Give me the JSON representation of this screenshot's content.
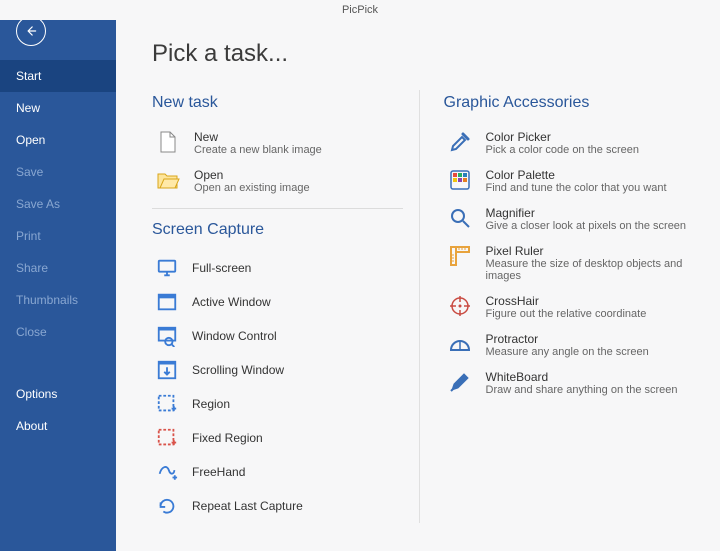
{
  "titlebar": {
    "title": "PicPick"
  },
  "sidebar": {
    "items": [
      {
        "label": "Start",
        "cls": "bright active"
      },
      {
        "label": "New",
        "cls": "bright"
      },
      {
        "label": "Open",
        "cls": "bright"
      },
      {
        "label": "Save",
        "cls": "dim"
      },
      {
        "label": "Save As",
        "cls": "dim"
      },
      {
        "label": "Print",
        "cls": "dim"
      },
      {
        "label": "Share",
        "cls": "dim"
      },
      {
        "label": "Thumbnails",
        "cls": "dim"
      },
      {
        "label": "Close",
        "cls": "dim"
      }
    ],
    "bottom": [
      {
        "label": "Options",
        "cls": "bright"
      },
      {
        "label": "About",
        "cls": "bright"
      }
    ]
  },
  "main": {
    "heading": "Pick a task...",
    "new_task": {
      "title": "New task",
      "items": [
        {
          "title": "New",
          "desc": "Create a new blank image"
        },
        {
          "title": "Open",
          "desc": "Open an existing image"
        }
      ]
    },
    "screen_capture": {
      "title": "Screen Capture",
      "items": [
        {
          "title": "Full-screen"
        },
        {
          "title": "Active Window"
        },
        {
          "title": "Window Control"
        },
        {
          "title": "Scrolling Window"
        },
        {
          "title": "Region"
        },
        {
          "title": "Fixed Region"
        },
        {
          "title": "FreeHand"
        },
        {
          "title": "Repeat Last Capture"
        }
      ]
    },
    "accessories": {
      "title": "Graphic Accessories",
      "items": [
        {
          "title": "Color Picker",
          "desc": "Pick a color code on the screen"
        },
        {
          "title": "Color Palette",
          "desc": "Find and tune the color that you want"
        },
        {
          "title": "Magnifier",
          "desc": "Give a closer look at pixels on the screen"
        },
        {
          "title": "Pixel Ruler",
          "desc": "Measure the size of desktop objects and images"
        },
        {
          "title": "CrossHair",
          "desc": "Figure out the relative coordinate"
        },
        {
          "title": "Protractor",
          "desc": "Measure any angle on the screen"
        },
        {
          "title": "WhiteBoard",
          "desc": "Draw and share anything on the screen"
        }
      ]
    }
  }
}
